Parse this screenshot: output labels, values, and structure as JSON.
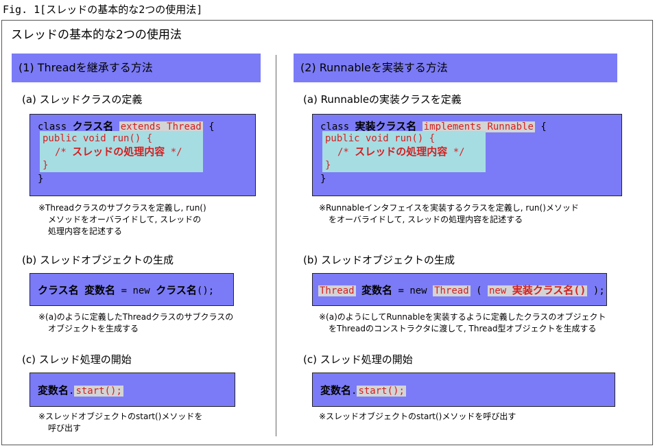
{
  "caption": "Fig. 1[スレッドの基本的な2つの使用法]",
  "frame_title": "スレッドの基本的な2つの使用法",
  "left": {
    "header": "(1) Threadを継承する方法",
    "a": {
      "title": "(a) スレッドクラスの定義",
      "kw_class": "class",
      "cls": "クラス名",
      "extends": "extends Thread",
      "open": "{",
      "run": "public void run() {",
      "comment_open": "/*",
      "comment_text": "スレッドの処理内容",
      "comment_close": "*/",
      "run_close": "}",
      "close": "}",
      "note_line1": "※Threadクラスのサブクラスを定義し, run()",
      "note_line2": "メソッドをオーバライドして, スレッドの",
      "note_line3": "処理内容を記述する"
    },
    "b": {
      "title": "(b) スレッドオブジェクトの生成",
      "cls": "クラス名",
      "var": "変数名",
      "eq_new": "= new",
      "ctor": "クラス名",
      "paren": "();",
      "note_line1": "※(a)のように定義したThreadクラスのサブクラスの",
      "note_line2": "オブジェクトを生成する"
    },
    "c": {
      "title": "(c) スレッド処理の開始",
      "var": "変数名",
      "dot": ".",
      "start": "start();",
      "note_line1": "※スレッドオブジェクトのstart()メソッドを",
      "note_line2": "呼び出す"
    }
  },
  "right": {
    "header": "(2) Runnableを実装する方法",
    "a": {
      "title": "(a) Runnableの実装クラスを定義",
      "kw_class": "class",
      "cls": "実装クラス名",
      "implements": "implements Runnable",
      "open": "{",
      "run": "public void run() {",
      "comment_open": "/*",
      "comment_text": "スレッドの処理内容",
      "comment_close": "*/",
      "run_close": "}",
      "close": "}",
      "note_line1": "※Runnableインタフェイスを実装するクラスを定義し, run()メソッド",
      "note_line2": "をオーバライドして, スレッドの処理内容を記述する"
    },
    "b": {
      "title": "(b) スレッドオブジェクトの生成",
      "thread": "Thread",
      "var": "変数名",
      "eq_new": "= new",
      "thread2": "Thread",
      "open_paren": "(",
      "new_kw": "new",
      "impl": "実装クラス名()",
      "close_paren": ");",
      "note_line1": "※(a)のようにしてRunnableを実装するように定義したクラスのオブジェクト",
      "note_line2": "をThreadのコンストラクタに渡して, Thread型オブジェクトを生成する"
    },
    "c": {
      "title": "(c) スレッド処理の開始",
      "var": "変数名",
      "dot": ".",
      "start": "start();",
      "note_line1": "※スレッドオブジェクトのstart()メソッドを呼び出す"
    }
  }
}
